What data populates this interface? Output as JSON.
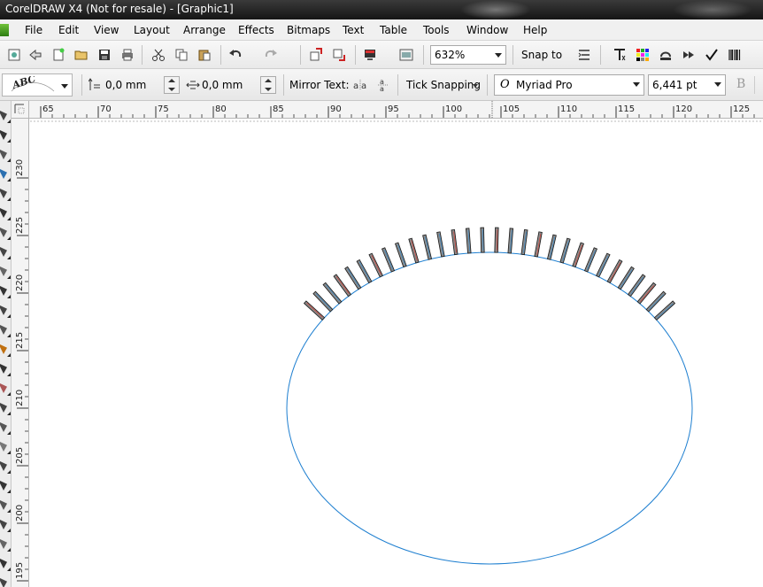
{
  "window": {
    "title": "CorelDRAW X4 (Not for resale) - [Graphic1]"
  },
  "menu": {
    "items": [
      "File",
      "Edit",
      "View",
      "Layout",
      "Arrange",
      "Effects",
      "Bitmaps",
      "Text",
      "Table",
      "Tools",
      "Window",
      "Help"
    ]
  },
  "standard_toolbar": {
    "zoom_level": "632%",
    "snap_to_label": "Snap to",
    "icons": [
      "new-icon",
      "open-icon",
      "save-icon",
      "print-icon",
      "cut-icon",
      "copy-icon",
      "paste-icon",
      "undo-icon",
      "redo-icon",
      "import-icon",
      "export-icon",
      "application-launcher-icon",
      "welcome-screen-icon",
      "options-icon",
      "text-properties-icon",
      "color-palette-icon",
      "corel-connect-icon",
      "publish-icon",
      "check-spelling-icon",
      "barcode-icon"
    ]
  },
  "property_bar": {
    "horizontal_offset": "0,0 mm",
    "vertical_offset": "0,0 mm",
    "mirror_text_label": "Mirror Text:",
    "tick_snapping_label": "Tick Snapping",
    "font_name": "Myriad Pro",
    "font_size": "6,441 pt",
    "text_path_preset_glyph": "ABC",
    "bold_label": "B"
  },
  "rulers": {
    "top_labels": [
      "65",
      "70",
      "75",
      "80",
      "85",
      "90",
      "95",
      "100",
      "105",
      "110",
      "115",
      "120",
      "125"
    ],
    "left_labels": [
      "230",
      "225",
      "220",
      "215",
      "210",
      "205",
      "200",
      "195"
    ]
  },
  "drawing": {
    "ellipse_color": "#1e7fd0",
    "tick_count": 30,
    "tick_fill": "#8a8a8a",
    "tick_outline": "#1a1a1a"
  },
  "colors": {
    "titlebar": "#1f1f1f",
    "menubar": "#f0f0f0",
    "toolbar": "#eeeeee",
    "canvas": "#ffffff"
  }
}
